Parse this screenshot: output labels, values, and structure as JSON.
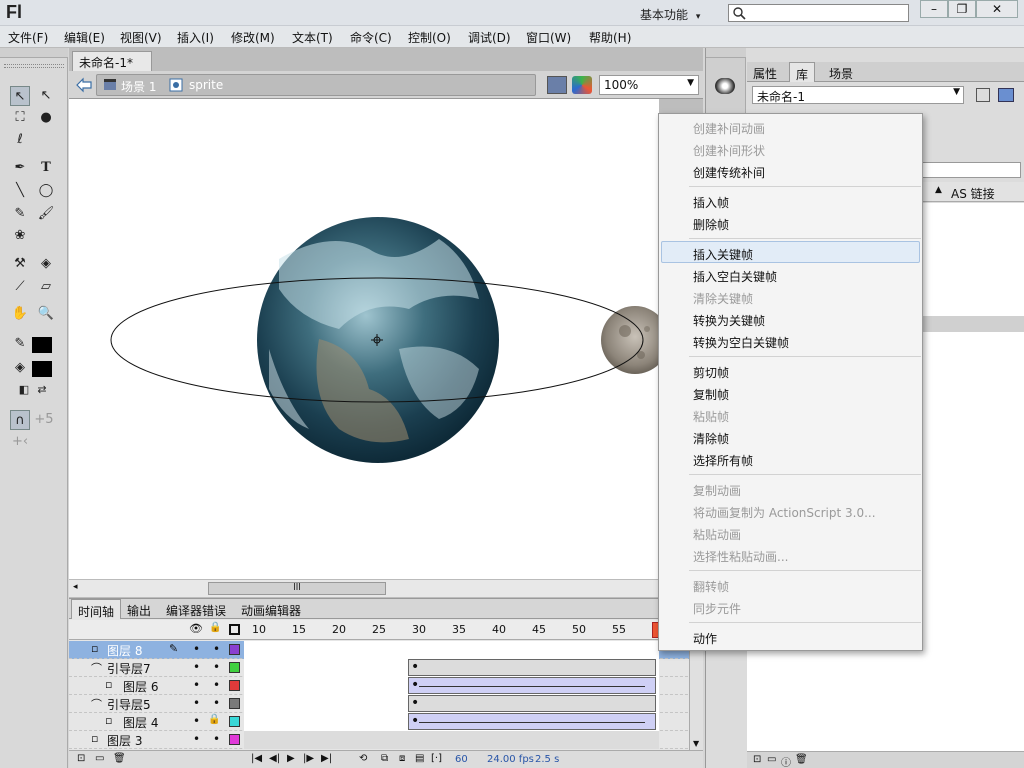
{
  "app": {
    "logo": "Fl",
    "workspace": "基本功能",
    "workspace_arrow": "▾",
    "search": {
      "placeholder": ""
    },
    "window_buttons": {
      "minimize": "–",
      "restore": "❐",
      "close": "✕"
    }
  },
  "menubar": [
    "文件(F)",
    "编辑(E)",
    "视图(V)",
    "插入(I)",
    "修改(M)",
    "文本(T)",
    "命令(C)",
    "控制(O)",
    "调试(D)",
    "窗口(W)",
    "帮助(H)"
  ],
  "document": {
    "tab": "未命名-1*",
    "tab_close": "×",
    "breadcrumb": {
      "scene": "场景 1",
      "symbol": "sprite"
    },
    "zoom": "100%"
  },
  "scrollbar": {
    "grip": "lll"
  },
  "right_panel": {
    "tabs": [
      "属性",
      "库",
      "场景"
    ],
    "library_select": "未命名-1",
    "column_header": "AS 链接"
  },
  "timeline": {
    "tabs": [
      "时间轴",
      "输出",
      "编译器错误",
      "动画编辑器"
    ],
    "ruler": [
      "10",
      "15",
      "20",
      "25",
      "30",
      "35",
      "40",
      "45",
      "50",
      "55"
    ],
    "layers": [
      {
        "name": "图层 8",
        "kind": "layer",
        "color": "#8a3fd0",
        "selected": true
      },
      {
        "name": "引导层7",
        "kind": "guide",
        "color": "#3fd03f"
      },
      {
        "name": "图层 6",
        "kind": "guided",
        "color": "#e03a3a"
      },
      {
        "name": "引导层5",
        "kind": "guide",
        "color": "#7a7a7a"
      },
      {
        "name": "图层 4",
        "kind": "guided",
        "color": "#3ad8d8",
        "locked": true
      },
      {
        "name": "图层 3",
        "kind": "layer",
        "color": "#e03ad8"
      }
    ],
    "status": {
      "frame": "60",
      "fps": "24.00 fps",
      "time": "2.5 s"
    }
  },
  "context_menu": {
    "items": [
      {
        "label": "创建补间动画",
        "enabled": false
      },
      {
        "label": "创建补间形状",
        "enabled": false
      },
      {
        "label": "创建传统补间",
        "enabled": true
      },
      {
        "label": "插入帧",
        "enabled": true
      },
      {
        "label": "删除帧",
        "enabled": true
      },
      {
        "label": "插入关键帧",
        "enabled": true,
        "highlighted": true
      },
      {
        "label": "插入空白关键帧",
        "enabled": true
      },
      {
        "label": "清除关键帧",
        "enabled": false
      },
      {
        "label": "转换为关键帧",
        "enabled": true
      },
      {
        "label": "转换为空白关键帧",
        "enabled": true
      },
      {
        "label": "剪切帧",
        "enabled": true
      },
      {
        "label": "复制帧",
        "enabled": true
      },
      {
        "label": "粘贴帧",
        "enabled": false
      },
      {
        "label": "清除帧",
        "enabled": true
      },
      {
        "label": "选择所有帧",
        "enabled": true
      },
      {
        "label": "复制动画",
        "enabled": false
      },
      {
        "label": "将动画复制为 ActionScript 3.0...",
        "enabled": false
      },
      {
        "label": "粘贴动画",
        "enabled": false
      },
      {
        "label": "选择性粘贴动画...",
        "enabled": false
      },
      {
        "label": "翻转帧",
        "enabled": false
      },
      {
        "label": "同步元件",
        "enabled": false
      },
      {
        "label": "动作",
        "enabled": true
      }
    ]
  }
}
